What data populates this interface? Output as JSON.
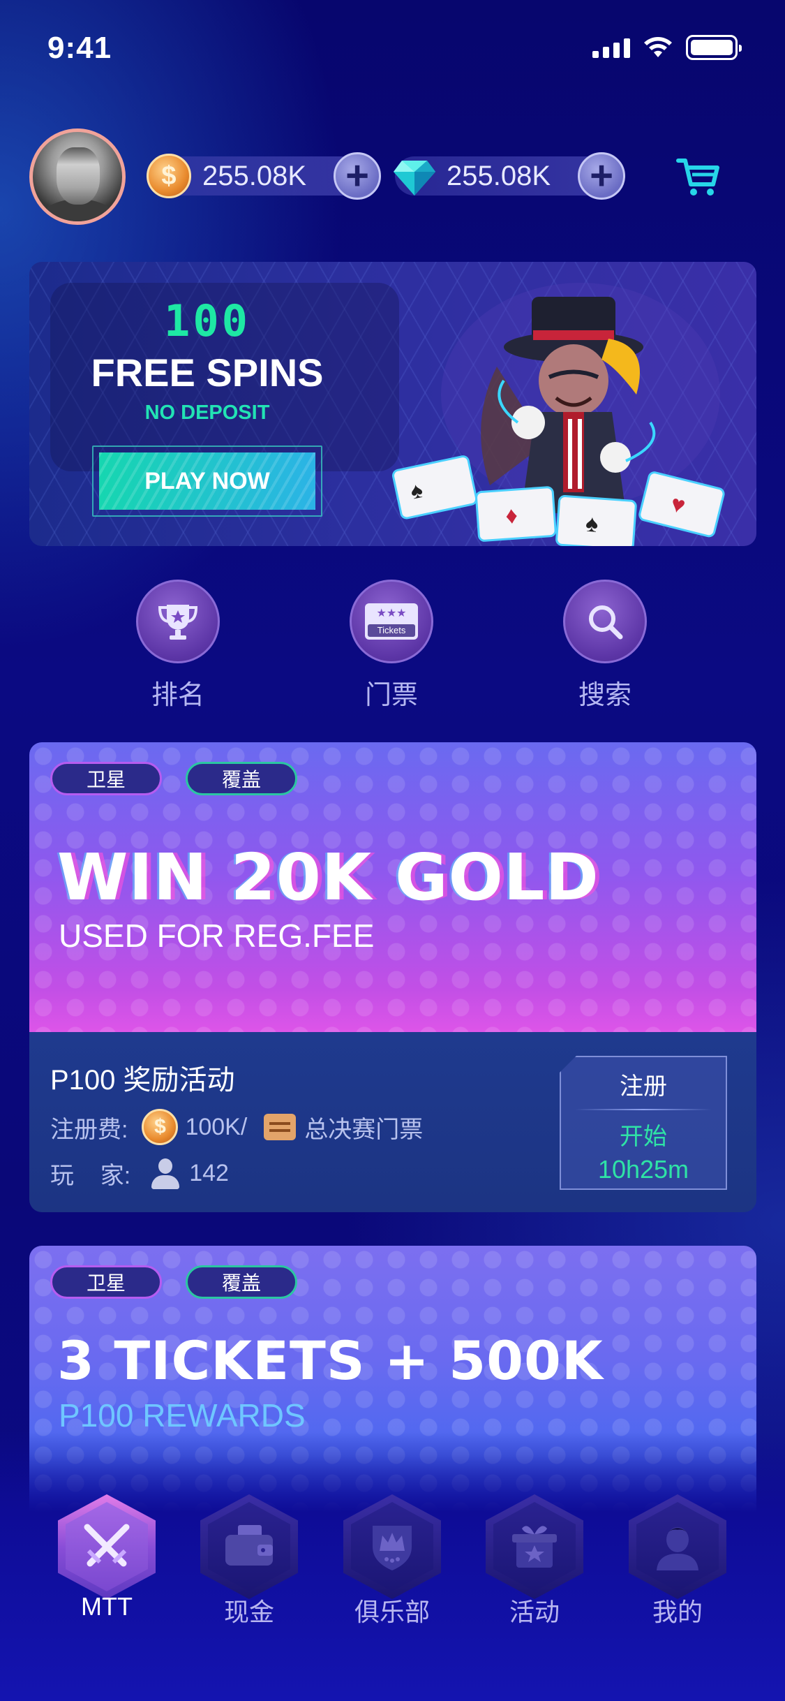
{
  "status_bar": {
    "time": "9:41"
  },
  "header": {
    "coins": "255.08K",
    "gems": "255.08K",
    "coin_symbol": "$"
  },
  "banner": {
    "count": "100",
    "title": "FREE SPINS",
    "subtitle": "NO DEPOSIT",
    "button": "PLAY NOW"
  },
  "quick_menu": [
    {
      "label": "排名",
      "icon": "trophy-icon"
    },
    {
      "label": "门票",
      "icon": "tickets-icon",
      "icon_text": "Tickets"
    },
    {
      "label": "搜索",
      "icon": "search-icon"
    }
  ],
  "events": [
    {
      "tags": [
        "卫星",
        "覆盖"
      ],
      "headline": "WIN 20K GOLD",
      "subline": "USED FOR REG.FEE",
      "name": "P100 奖励活动",
      "fee_label": "注册费:",
      "fee_amount": "100K/",
      "fee_ticket": "总决赛门票",
      "players_label": "玩    家:",
      "players": "142",
      "register": "注册",
      "start": "开始",
      "countdown": "10h25m"
    },
    {
      "tags": [
        "卫星",
        "覆盖"
      ],
      "headline": "3 TICKETS + 500K",
      "subline": "P100 REWARDS"
    }
  ],
  "nav": [
    {
      "label": "MTT",
      "icon": "crossed-swords-icon",
      "active": true
    },
    {
      "label": "现金",
      "icon": "wallet-icon",
      "active": false
    },
    {
      "label": "俱乐部",
      "icon": "crown-shield-icon",
      "active": false
    },
    {
      "label": "活动",
      "icon": "gift-box-icon",
      "active": false
    },
    {
      "label": "我的",
      "icon": "profile-icon",
      "active": false
    }
  ],
  "colors": {
    "accent_green": "#1ee8a4",
    "background": "#0b0a82",
    "card_gradient_end": "#dd55e8"
  }
}
